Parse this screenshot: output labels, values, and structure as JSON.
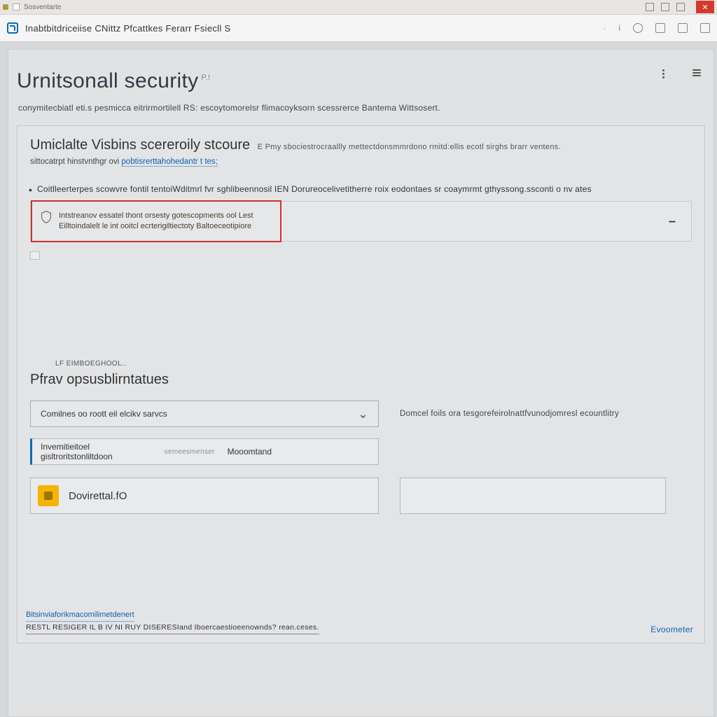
{
  "chrome": {
    "tab_label": "Sosventarte"
  },
  "address_bar": {
    "title": "Inabtbitdriceiise CNittz Pfcattkes Ferarr Fsiecll S"
  },
  "page": {
    "title": "Urnitsonall security",
    "title_suffix": "P.!",
    "intro": "conymitecbiatl eti.s pesmicca eitrirmortilell RS: escoytomorelsr flimacoyksorn scessrerce Bantema Wittsosert."
  },
  "card": {
    "heading": "Umiclalte Visbins scereroily stcoure",
    "heading_suffix": "E  Pmy sbociestrocraallly mettectdonsmmrdono rmitd:ellis ecotl sirghs brarr ventens.",
    "subline_prefix": "sittocatrpt hinstvnthgr ovi",
    "subline_link": "pobtisrerttahohedantr t tes;",
    "bullet": "Coitlleerterpes scowvre fontil tentoiWditmrl fvr sghlibeennosil IEN Dorureocelivetitherre roix eodontaes sr coaymrmt gthyssong.ssconti o nv ates",
    "alert_line1": "Intstreanov essatel thont orsesty gotescopments ool Lest",
    "alert_line2": "Eilltoindalelt le int ooitcl ecrterigiltiectoty Baltoeceotipiore",
    "alert_minimize": "–"
  },
  "section2": {
    "heading": "Pfrav opsusblirntatues",
    "dropdown_label": "LF  EIMBOEGHOOL..",
    "dropdown_value": "Comilnes oo roott eil elcikv sarvcs",
    "side_note": "Domcel foils ora tesgorefeirolnattfvunodjomresl ecountlitry",
    "field_text": "Invemitieitoel gisltroritstonliltdoon",
    "field_placeholder": "semeesmenser",
    "field_tag": "Mooomtand",
    "yellow_label": "Dovirettal.fO"
  },
  "footer": {
    "link1": "Bitsinviaforikmacomilimetdenert",
    "link2": "RESTL RESIGER IL B IV NI RUY DISERESIand Iboercaestioeenownds? rean.ceses.",
    "close": "Evoometer"
  }
}
